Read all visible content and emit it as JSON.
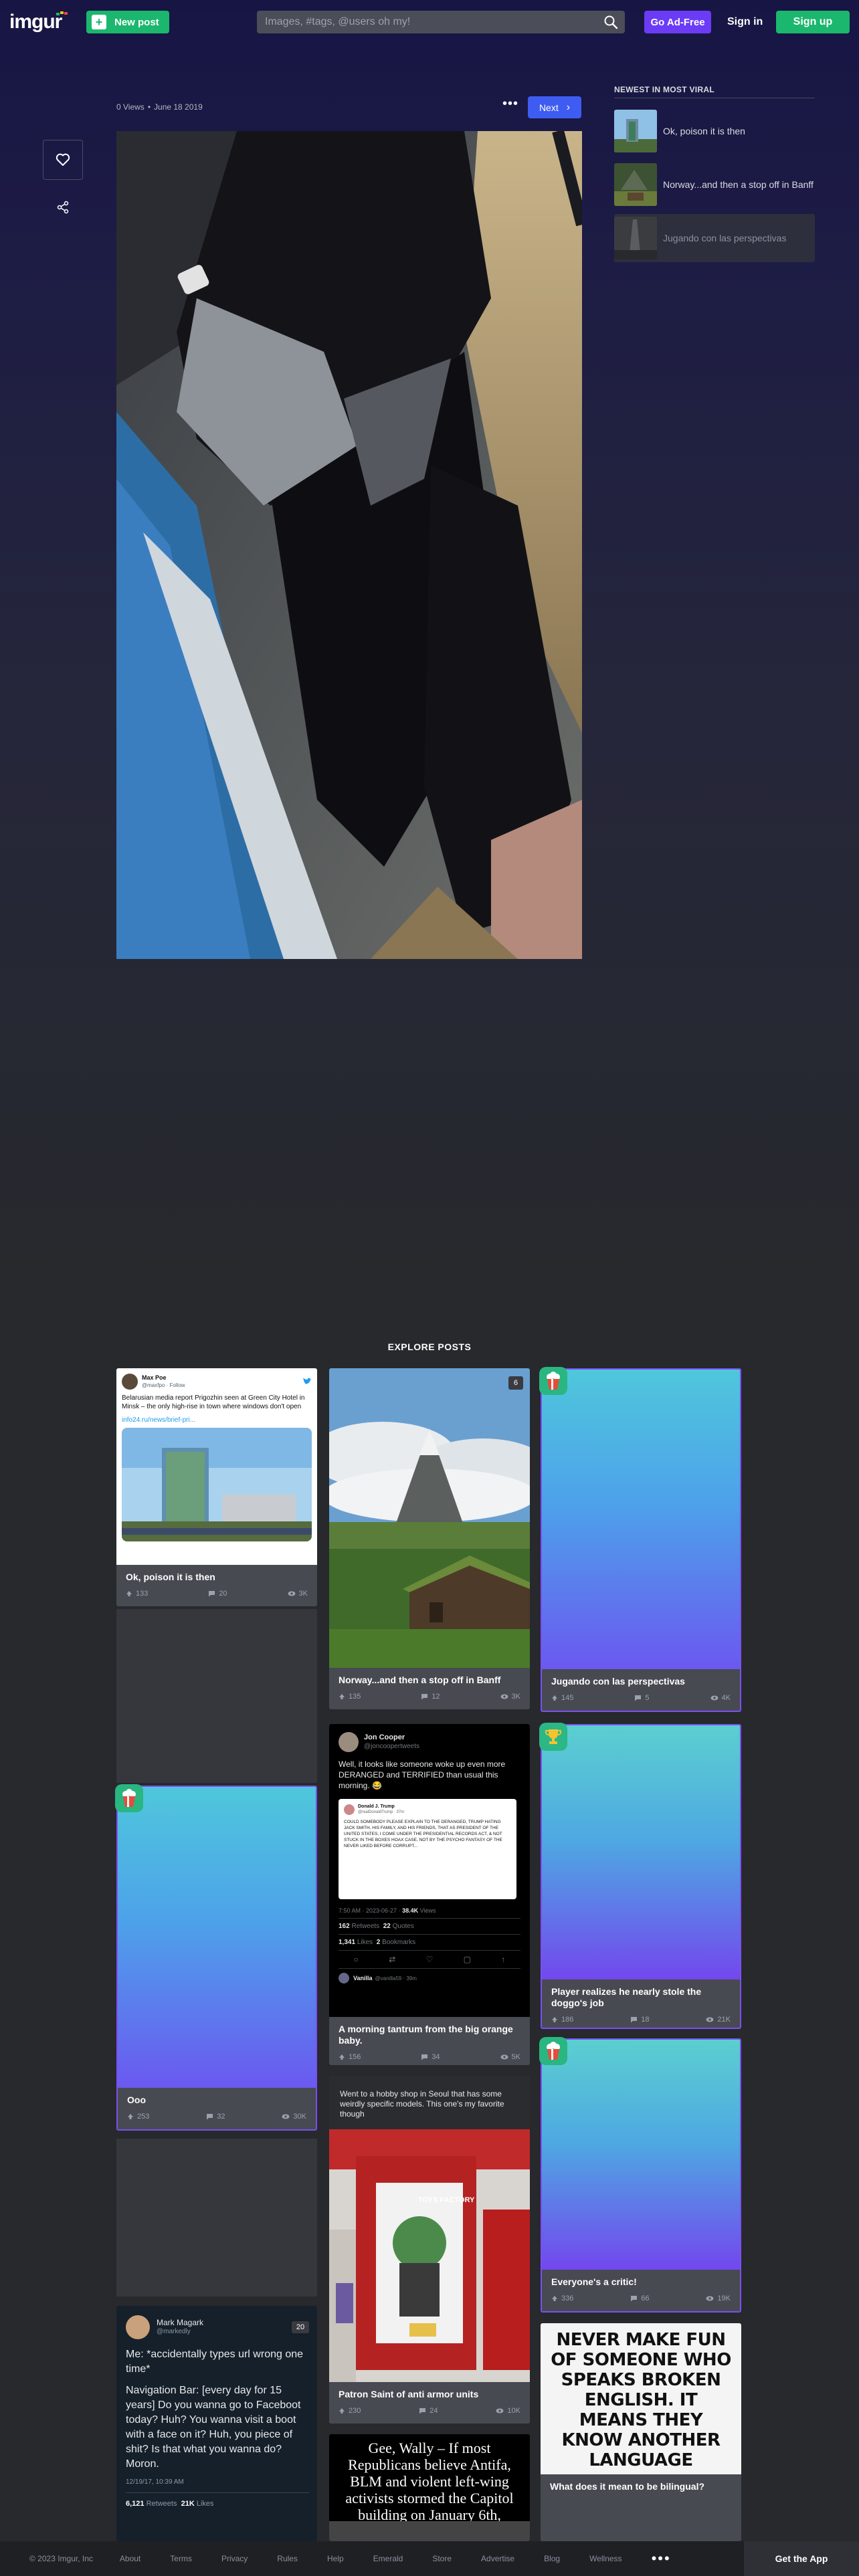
{
  "nav": {
    "logo": "imgur",
    "new_post": "New post",
    "search_placeholder": "Images, #tags, @users oh my!",
    "go_ad_free": "Go Ad-Free",
    "sign_in": "Sign in",
    "sign_up": "Sign up"
  },
  "post": {
    "views": "0 Views",
    "date": "June 18 2019",
    "more": "•••",
    "next": "Next"
  },
  "sidebar": {
    "title": "NEWEST IN MOST VIRAL",
    "items": [
      {
        "title": "Ok, poison it is then"
      },
      {
        "title": "Norway...and then a stop off in Banff"
      },
      {
        "title": "Jugando con las perspectivas"
      }
    ]
  },
  "explore": {
    "title": "EXPLORE POSTS",
    "cards": [
      {
        "title": "Ok, poison it is then",
        "ups": "133",
        "comments": "20",
        "views": "3K",
        "tweet": {
          "name": "Max Poe",
          "handle": "@maxfpo · Follow",
          "text": "Belarusian media report Prigozhin seen at Green City Hotel in Minsk – the only high-rise in town where windows don't open",
          "link": "info24.ru/news/brief-pri..."
        }
      },
      {
        "title": "Norway...and then a stop off in Banff",
        "ups": "135",
        "comments": "12",
        "views": "3K",
        "count": "6"
      },
      {
        "title": "Jugando con las perspectivas",
        "ups": "145",
        "comments": "5",
        "views": "4K"
      },
      {
        "title": "A morning tantrum from the big orange baby.",
        "ups": "156",
        "comments": "34",
        "views": "5K",
        "tweet": {
          "name": "Jon Cooper",
          "handle": "@joncoopertweets",
          "text": "Well, it looks like someone woke up even more DERANGED and TERRIFIED than usual this morning. 😂",
          "inner_name": "Donald J. Trump",
          "inner_handle": "@realDonaldTrump · 37m",
          "inner_text": "COULD SOMEBODY PLEASE EXPLAIN TO THE DERANGED, TRUMP HATING JACK SMITH, HIS FAMILY, AND HIS FRIENDS, THAT AS PRESIDENT OF THE UNITED STATES, I COME UNDER THE PRESIDENTIAL RECORDS ACT, & NOT STUCK IN THE BOXES HOAX CASE, NOT BY THE PSYCHO FANTASY OF THE NEVER LIKED BEFORE CORRUPT...",
          "time": "7:50 AM · 2023-06-27",
          "views_count": "38.4K",
          "views_label": "Views",
          "retweets": "162",
          "retweets_label": "Retweets",
          "quotes": "22",
          "quotes_label": "Quotes",
          "likes": "1,341",
          "likes_label": "Likes",
          "bookmarks": "2",
          "bookmarks_label": "Bookmarks",
          "reply_name": "Vanilla",
          "reply_handle": "@vanilla59 · 39m"
        }
      },
      {
        "title": "Player realizes he nearly stole the doggo's job",
        "ups": "186",
        "comments": "18",
        "views": "21K"
      },
      {
        "title": "Ooo",
        "ups": "253",
        "comments": "32",
        "views": "30K"
      },
      {
        "title": "Patron Saint of anti armor units",
        "ups": "230",
        "comments": "24",
        "views": "10K",
        "caption": "Went to a hobby shop in Seoul that has some weirdly specific models. This one's my favorite though",
        "box_brand": "TOYS FACTORY"
      },
      {
        "title": "Everyone's a critic!",
        "ups": "336",
        "comments": "66",
        "views": "19K"
      },
      {
        "title": "What does it mean to be bilingual?",
        "sign_text": "NEVER MAKE FUN OF SOMEONE WHO SPEAKS BROKEN ENGLISH. IT MEANS THEY KNOW ANOTHER LANGUAGE"
      },
      {
        "tweet": {
          "name": "Mark Magark",
          "handle": "@markedly",
          "count": "20",
          "text1": "Me: *accidentally types url wrong one time*",
          "text2": "Navigation Bar: [every day for 15 years] Do you wanna go to Faceboot today? Huh? You wanna visit a boot with a face on it? Huh, you piece of shit? Is that what you wanna do? Moron.",
          "time": "12/19/17, 10:39 AM",
          "retweets": "6,121",
          "retweets_label": "Retweets",
          "likes": "21K",
          "likes_label": "Likes"
        }
      },
      {
        "quote": "Gee, Wally – If most Republicans believe Antifa, BLM and violent left-wing activists stormed the Capitol building on January 6th,"
      }
    ]
  },
  "footer": {
    "copyright": "© 2023 Imgur, Inc",
    "links": [
      "About",
      "Terms",
      "Privacy",
      "Rules",
      "Help",
      "Emerald",
      "Store",
      "Advertise",
      "Blog",
      "Wellness"
    ],
    "more": "•••",
    "get_app": "Get the App"
  },
  "colors": {
    "green": "#1bb76e",
    "purple": "#6b3bf5",
    "blue": "#3f5cf2"
  }
}
